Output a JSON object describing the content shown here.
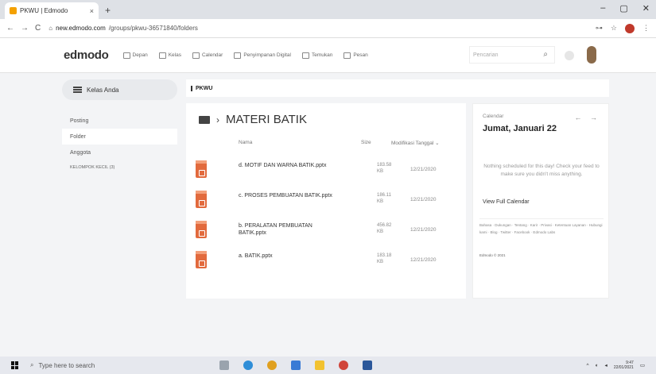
{
  "browser": {
    "tab_title": "PKWU | Edmodo",
    "tab_close": "×",
    "new_tab": "+",
    "url_prefix": "new.edmodo.com",
    "url_path": "/groups/pkwu-36571840/folders",
    "window_controls": [
      "–",
      "▢",
      "✕"
    ]
  },
  "topnav": {
    "logo": "edmodo",
    "items": [
      "Depan",
      "Kelas",
      "Calendar",
      "Penyimpanan Digital",
      "Temukan",
      "Pesan"
    ],
    "search_placeholder": "Pencarian"
  },
  "sidebar": {
    "class_button": "Kelas Anda",
    "items": [
      "Posting",
      "Folder",
      "Anggota"
    ],
    "small_group": "KELOMPOK KECIL (3)"
  },
  "breadcrumb": "PKWU",
  "folder": {
    "name": "MATERI BATIK",
    "columns": {
      "name": "Nama",
      "size": "Size",
      "modified": "Modifikasi Tanggal ⌄"
    },
    "files": [
      {
        "name": "d. MOTIF DAN WARNA BATIK.pptx",
        "size": "183.58 KB",
        "date": "12/21/2020"
      },
      {
        "name": "c. PROSES PEMBUATAN BATIK.pptx",
        "size": "186.11 KB",
        "date": "12/21/2020"
      },
      {
        "name": "b. PERALATAN PEMBUATAN BATIK.pptx",
        "size": "456.82 KB",
        "date": "12/21/2020"
      },
      {
        "name": "a. BATIK.pptx",
        "size": "183.18 KB",
        "date": "12/21/2020"
      }
    ]
  },
  "calendar": {
    "label": "Calendar",
    "arrows": "← →",
    "date": "Jumat, Januari 22",
    "empty_message": "Nothing scheduled for this day! Check your feed to make sure you didn't miss anything.",
    "link": "View Full Calendar",
    "footer_links": "Bahasa · Dukungan · Tentang · Karir · Privasi · Ketentuan Layanan · Hubungi kami · Blog · Twitter · Facebook · Edmodo Labs",
    "copyright": "Edmodo © 2021"
  },
  "taskbar": {
    "search_placeholder": "Type here to search",
    "time": "9:47",
    "date": "22/01/2021"
  }
}
